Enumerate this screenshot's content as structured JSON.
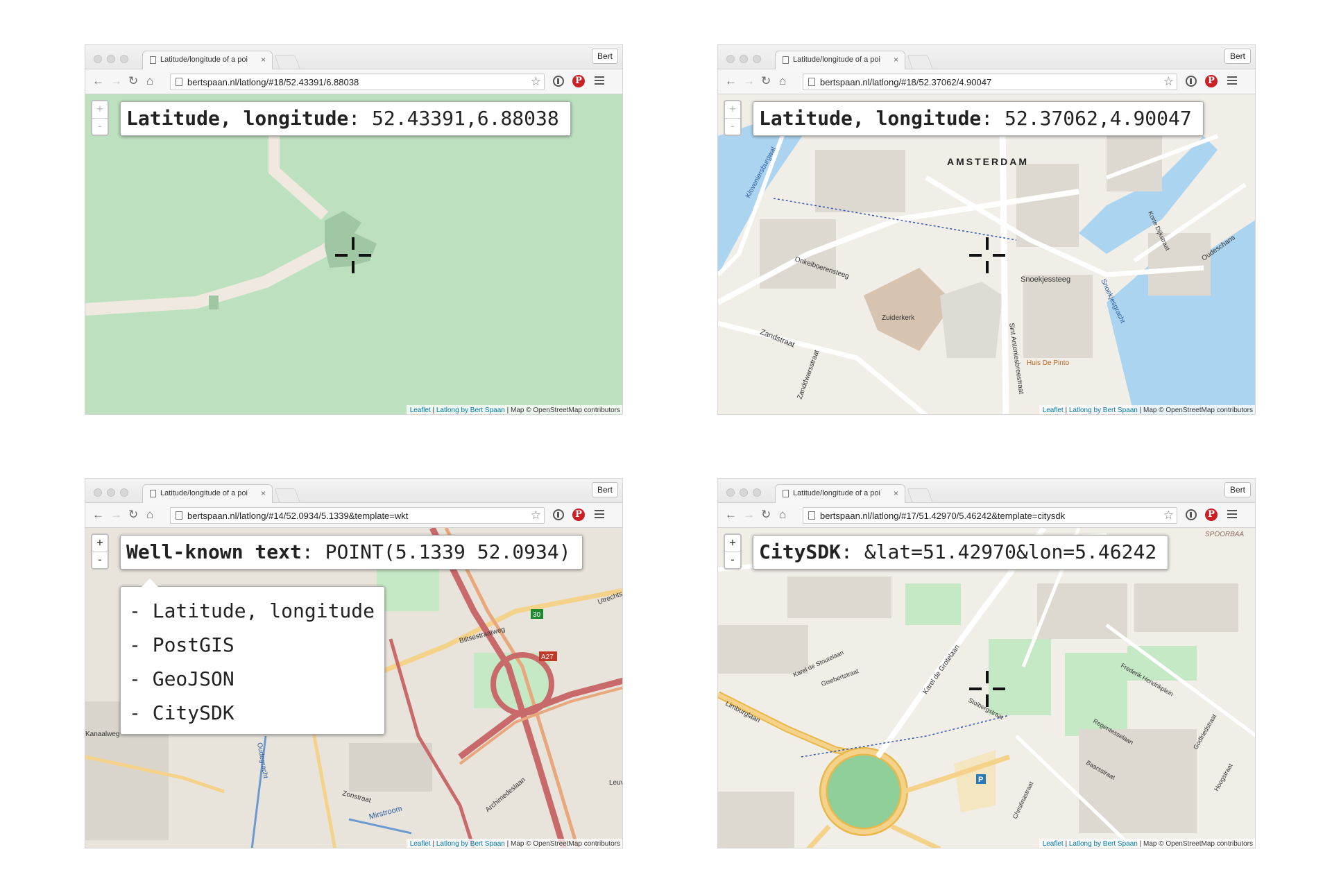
{
  "colors": {
    "tile_green": "#bde1bf",
    "city_bg": "#f1eee8",
    "water": "#abd4f0",
    "park": "#c5e8c5",
    "motorway": "#e8a77c",
    "trunk": "#c96a6a",
    "primary": "#f5d28a",
    "link": "#0078a8",
    "pinterest": "#cb2027"
  },
  "windows": [
    {
      "tab_title": "Latitude/longitude of a poi",
      "profile": "Bert",
      "url": "bertspaan.nl/latlong/#18/52.43391/6.88038",
      "map_style": "green",
      "coord_label": "Latitude, longitude",
      "coord_sep": ":",
      "coord_value": "52.43391,6.88038",
      "map_labels": [],
      "attribution": {
        "leaflet": "Leaflet",
        "sep1": " | ",
        "latlong": "Latlong by Bert Spaan",
        "rest": " | Map © OpenStreetMap contributors"
      }
    },
    {
      "tab_title": "Latitude/longitude of a poi",
      "profile": "Bert",
      "url": "bertspaan.nl/latlong/#18/52.37062/4.90047",
      "map_style": "city",
      "coord_label": "Latitude, longitude",
      "coord_sep": ":",
      "coord_value": "52.37062,4.90047",
      "map_labels": [
        "AMSTERDAM",
        "Zuiderkerk",
        "Snoekjessteeg",
        "Onkelboerensteeg",
        "Zandstraat",
        "Sint Antoniesbreestraat",
        "Huis De Pinto",
        "Oudeschans",
        "Kloveniersburgwal",
        "Korte Dijkstraat",
        "Snoekjesgracht",
        "Zanddwarsstraat"
      ],
      "attribution": {
        "leaflet": "Leaflet",
        "sep1": " | ",
        "latlong": "Latlong by Bert Spaan",
        "rest": " | Map © OpenStreetMap contributors"
      }
    },
    {
      "tab_title": "Latitude/longitude of a poi",
      "profile": "Bert",
      "url": "bertspaan.nl/latlong/#14/52.0934/5.1339&template=wkt",
      "map_style": "utrecht",
      "coord_label": "Well-known text",
      "coord_sep": ":",
      "coord_value": "POINT(5.1339 52.0934)",
      "dropdown": [
        "- Latitude, longitude",
        "- PostGIS",
        "- GeoJSON",
        "- CitySDK"
      ],
      "map_labels": [
        "Biltsestraatweg",
        "Utrechts",
        "A27",
        "30",
        "Oudegracht",
        "Kanaalweg",
        "Archimedeslaan",
        "Zonstraat",
        "Mirstroom",
        "Leuv"
      ],
      "attribution": {
        "leaflet": "Leaflet",
        "sep1": " | ",
        "latlong": "Latlong by Bert Spaan",
        "rest": " | Map © OpenStreetMap contributors"
      }
    },
    {
      "tab_title": "Latitude/longitude of a poi",
      "profile": "Bert",
      "url": "bertspaan.nl/latlong/#17/51.42970/5.46242&template=citysdk",
      "map_style": "eindhoven",
      "coord_label": "CitySDK",
      "coord_sep": ":",
      "coord_value": "&lat=51.42970&lon=5.46242",
      "map_labels": [
        "SPOORBAA",
        "Limburglaan",
        "Karel de Grotelaan",
        "Karel de Stoutelaan",
        "Gisebertstraat",
        "Stoibergstraat",
        "Frederik Hendrikplein",
        "Regentesselaan",
        "Baarsstraat",
        "Christinastraat",
        "Hoogstraat",
        "Godfriedstraat"
      ],
      "attribution": {
        "leaflet": "Leaflet",
        "sep1": " | ",
        "latlong": "Latlong by Bert Spaan",
        "rest": " | Map © OpenStreetMap contributors"
      }
    }
  ]
}
